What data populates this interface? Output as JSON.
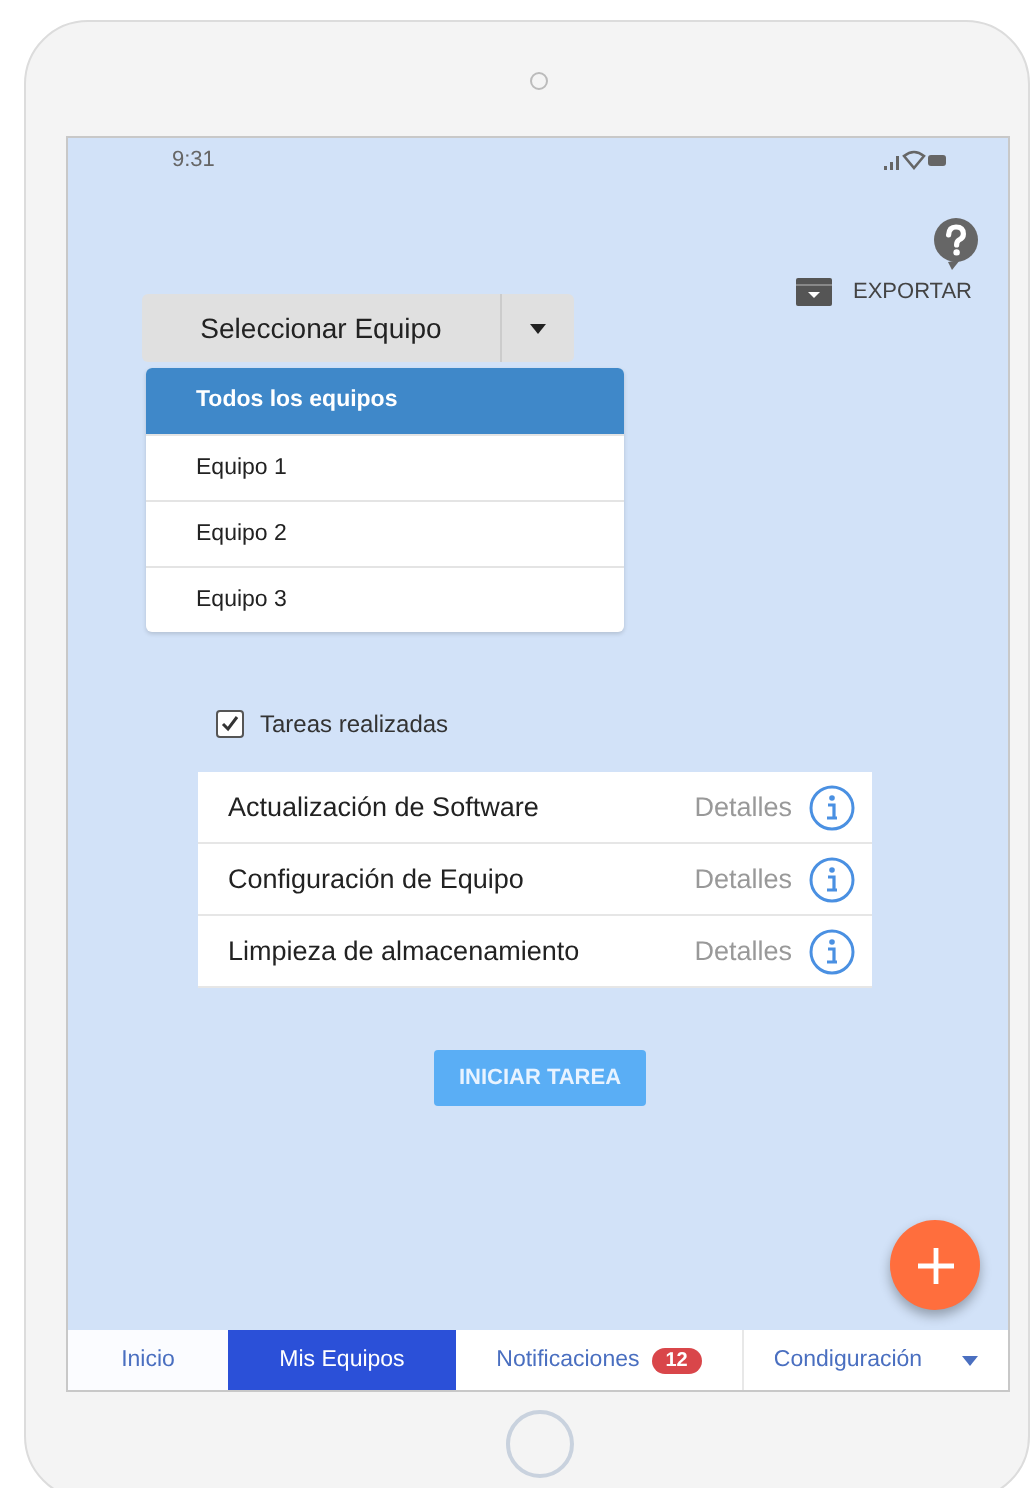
{
  "status_bar": {
    "time": "9:31"
  },
  "export": {
    "label": "EXPORTAR"
  },
  "team_select": {
    "label": "Seleccionar Equipo",
    "expanded": true,
    "options": [
      {
        "label": "Todos los equipos",
        "selected": true
      },
      {
        "label": "Equipo 1",
        "selected": false
      },
      {
        "label": "Equipo 2",
        "selected": false
      },
      {
        "label": "Equipo 3",
        "selected": false
      }
    ]
  },
  "done_filter": {
    "label": "Tareas realizadas",
    "checked": true
  },
  "tasks": [
    {
      "name": "Actualización de Software",
      "link": "Detalles"
    },
    {
      "name": "Configuración de Equipo",
      "link": "Detalles"
    },
    {
      "name": "Limpieza de almacenamiento",
      "link": "Detalles"
    }
  ],
  "start_button": {
    "label": "INICIAR TAREA"
  },
  "nav": [
    {
      "label": "Inicio",
      "selected": false
    },
    {
      "label": "Mis Equipos",
      "selected": true
    },
    {
      "label": "Notificaciones",
      "selected": false,
      "badge": "12"
    },
    {
      "label": "Condiguración",
      "selected": false,
      "dropdown": true
    }
  ]
}
